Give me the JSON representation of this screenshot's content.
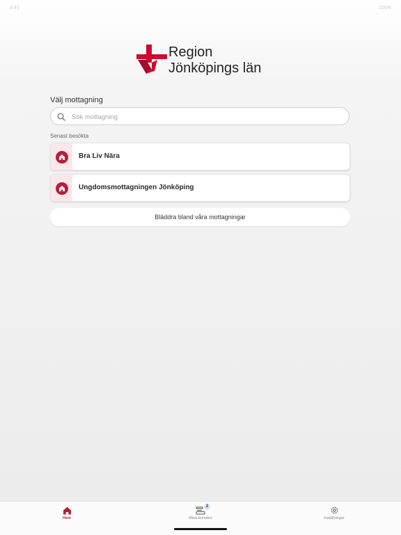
{
  "status": {
    "left": "9:41",
    "right": "100%"
  },
  "logo": {
    "line1": "Region",
    "line2": "Jönköpings län"
  },
  "section_title": "Välj mottagning",
  "search": {
    "placeholder": "Sök mottagning",
    "value": ""
  },
  "recent_label": "Senast besökta",
  "recent": [
    {
      "label": "Bra Liv Nära"
    },
    {
      "label": "Ungdomsmottagningen Jönköping"
    }
  ],
  "browse_label": "Bläddra bland våra mottagningar",
  "tabs": [
    {
      "label": "Hem",
      "icon": "home-icon",
      "active": true
    },
    {
      "label": "Mina ärenden",
      "icon": "cases-icon",
      "badge": "2",
      "active": false
    },
    {
      "label": "Inställningar",
      "icon": "gear-icon",
      "active": false
    }
  ],
  "colors": {
    "accent": "#b51f3c",
    "accent_light": "#fbe7ea"
  }
}
